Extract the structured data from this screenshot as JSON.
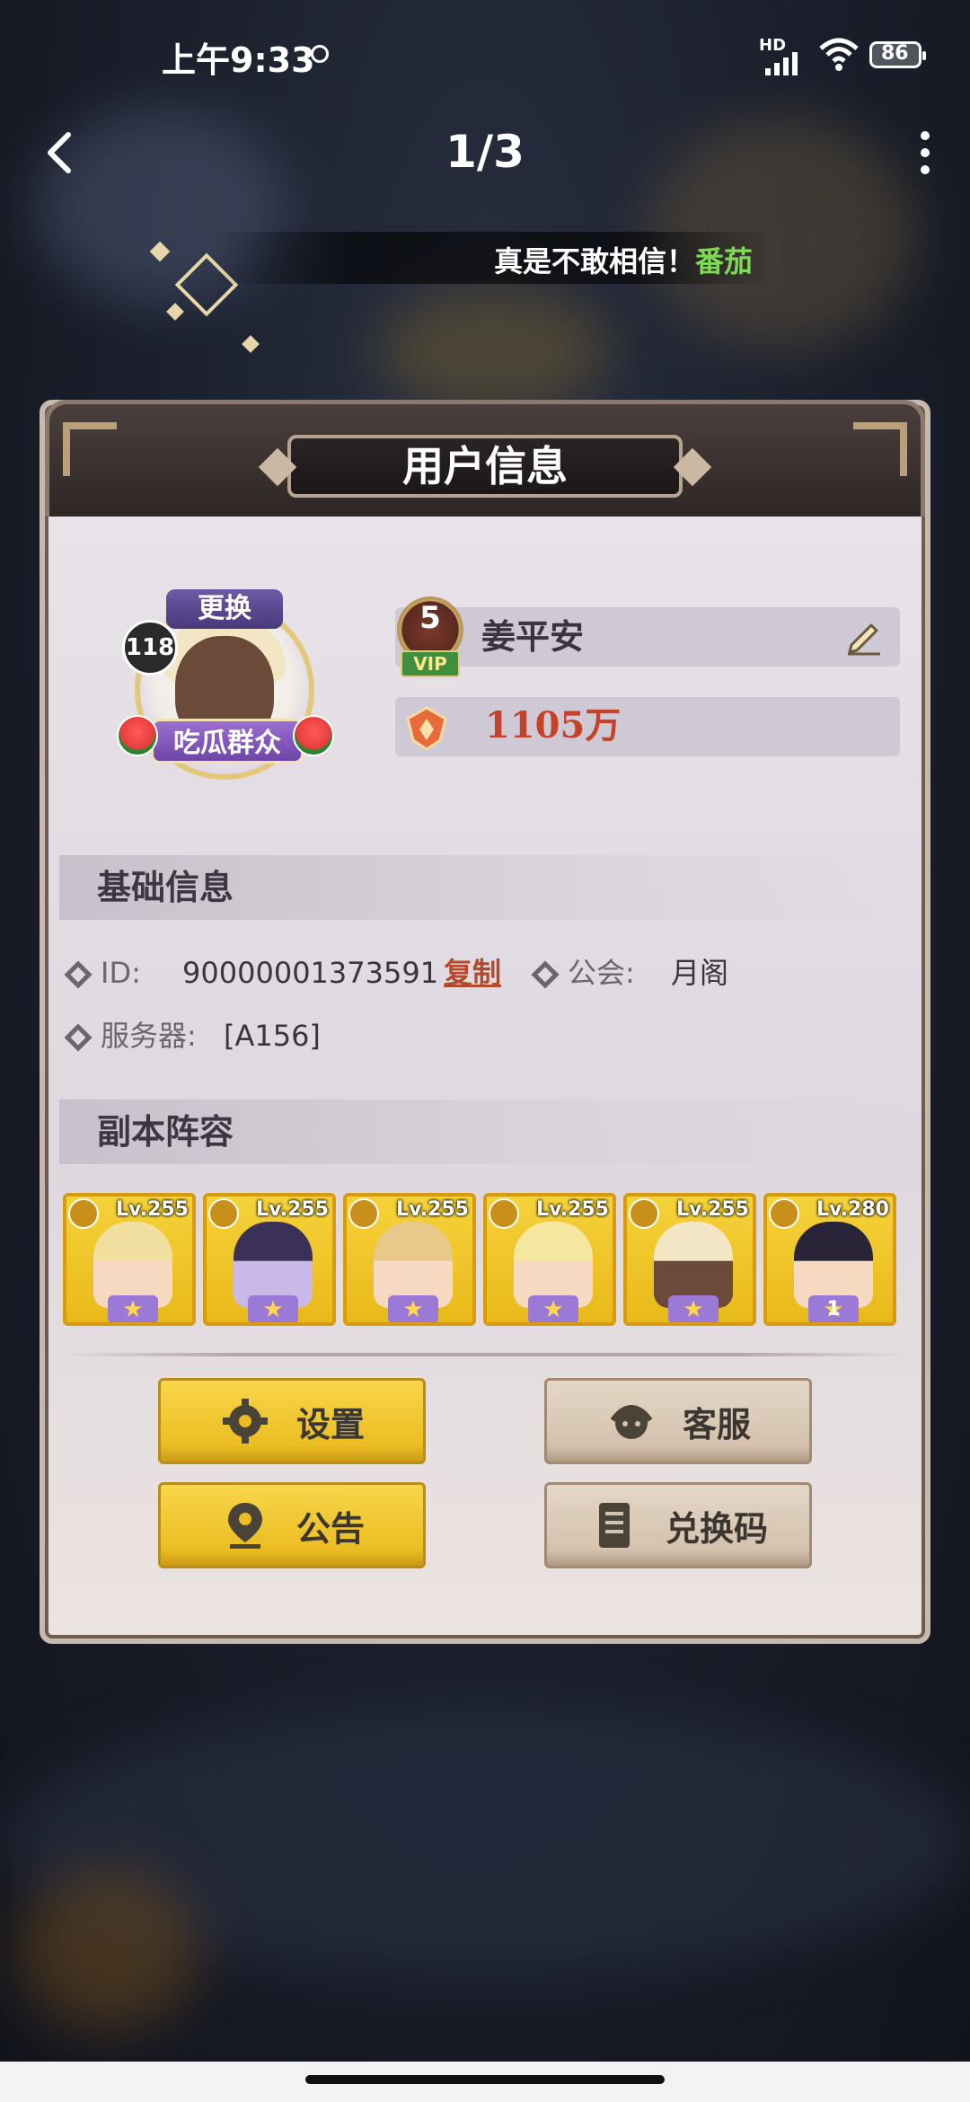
{
  "status_bar": {
    "time": "上午9:33",
    "network": "HD",
    "battery": "86"
  },
  "nav": {
    "page_counter": "1/3"
  },
  "marquee": {
    "text": "真是不敢相信！",
    "highlight": "番茄"
  },
  "dialog": {
    "title": "用户信息",
    "avatar": {
      "change_label": "更换",
      "level": "118",
      "title_badge": "吃瓜群众"
    },
    "vip_level": "5",
    "vip_label": "VIP",
    "player_name": "姜平安",
    "power": "1105万",
    "basic_section": {
      "title": "基础信息",
      "id_label": "ID:",
      "id_value": "90000001373591",
      "copy_label": "复制",
      "guild_label": "公会:",
      "guild_value": "月阁",
      "server_label": "服务器:",
      "server_value": "[A156]"
    },
    "lineup_section": {
      "title": "副本阵容",
      "heroes": [
        {
          "level": "Lv.255",
          "hair": "#f1dfa0",
          "skin": "#f6d9c0",
          "stars": ""
        },
        {
          "level": "Lv.255",
          "hair": "#3a3058",
          "skin": "#c9b9e6",
          "stars": ""
        },
        {
          "level": "Lv.255",
          "hair": "#e8c98a",
          "skin": "#f6d9c0",
          "stars": ""
        },
        {
          "level": "Lv.255",
          "hair": "#f5e6a0",
          "skin": "#f6d9c0",
          "stars": ""
        },
        {
          "level": "Lv.255",
          "hair": "#f3e6c4",
          "skin": "#6b4a3a",
          "stars": ""
        },
        {
          "level": "Lv.280",
          "hair": "#2a2438",
          "skin": "#f6d9c0",
          "stars": "1"
        }
      ]
    },
    "buttons": {
      "settings": "设置",
      "support": "客服",
      "announcement": "公告",
      "redeem": "兑换码"
    }
  },
  "colors": {
    "accent_yellow": "#ebbd22",
    "accent_beige": "#d4c2ae",
    "power_red": "#c6402a",
    "copy_red": "#b24a2e"
  }
}
